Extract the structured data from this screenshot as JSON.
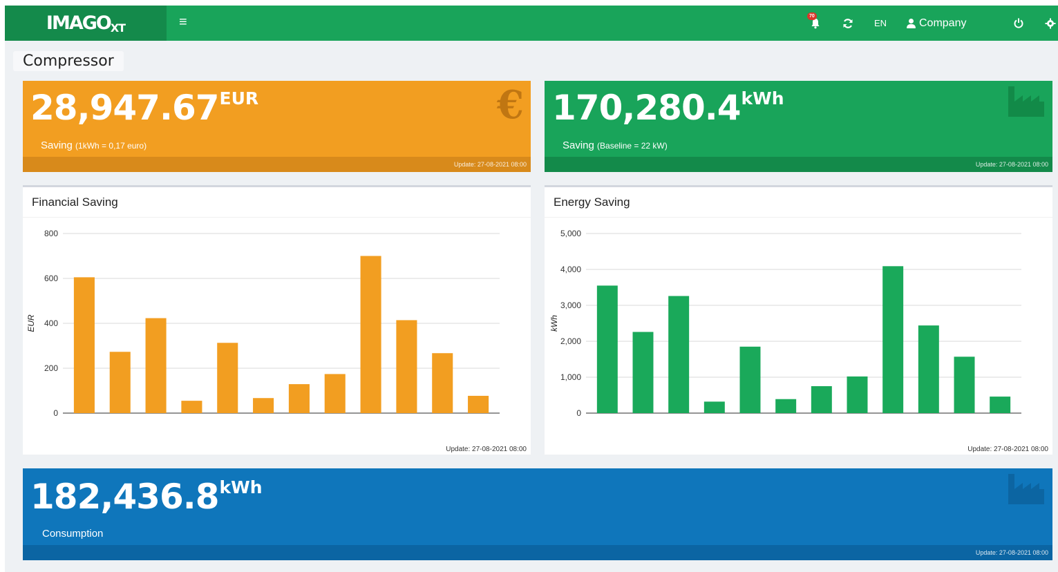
{
  "topbar": {
    "logo_text": "IMAGO",
    "logo_sub": "XT",
    "notification_count": "70",
    "language": "EN",
    "user_label": "Company",
    "colors": {
      "bar": "#19a45a",
      "logo_bg": "#148a4b"
    }
  },
  "page_title": "Compressor",
  "tiles": {
    "financial": {
      "value": "28,947.67",
      "unit": "EUR",
      "label": "Saving",
      "label_note": "(1kWh = 0,17 euro)",
      "update": "Update: 27-08-2021 08:00",
      "icon": "euro-icon",
      "icon_glyph": "€",
      "color": "#f29e21"
    },
    "energy": {
      "value": "170,280.4",
      "unit": "kWh",
      "label": "Saving",
      "label_note": "(Baseline = 22 kW)",
      "update": "Update: 27-08-2021 08:00",
      "icon": "factory-icon",
      "color": "#19a45a"
    },
    "consumption": {
      "value": "182,436.8",
      "unit": "kWh",
      "label": "Consumption",
      "update": "Update: 27-08-2021 08:00",
      "icon": "factory-icon",
      "color": "#0f76bb"
    }
  },
  "cards": {
    "financial": {
      "title": "Financial Saving",
      "update": "Update: 27-08-2021 08:00"
    },
    "energy": {
      "title": "Energy Saving",
      "update": "Update: 27-08-2021 08:00"
    }
  },
  "chart_data": [
    {
      "type": "bar",
      "title": "Financial Saving",
      "xlabel": "",
      "ylabel": "EUR",
      "ylim": [
        0,
        800
      ],
      "yticks": [
        "0",
        "200",
        "400",
        "600",
        "800"
      ],
      "ytick_values": [
        0,
        200,
        400,
        600,
        800
      ],
      "values": [
        605,
        273,
        423,
        55,
        313,
        67,
        129,
        174,
        700,
        414,
        267,
        77
      ],
      "color": "#f29e21",
      "grid": true
    },
    {
      "type": "bar",
      "title": "Energy Saving",
      "xlabel": "",
      "ylabel": "kWh",
      "ylim": [
        0,
        5000
      ],
      "yticks": [
        "0",
        "1,000",
        "2,000",
        "3,000",
        "4,000",
        "5,000"
      ],
      "ytick_values": [
        0,
        1000,
        2000,
        3000,
        4000,
        5000
      ],
      "values": [
        3550,
        2260,
        3260,
        320,
        1850,
        390,
        750,
        1020,
        4090,
        2440,
        1570,
        460
      ],
      "color": "#1aa95a",
      "grid": true
    }
  ]
}
